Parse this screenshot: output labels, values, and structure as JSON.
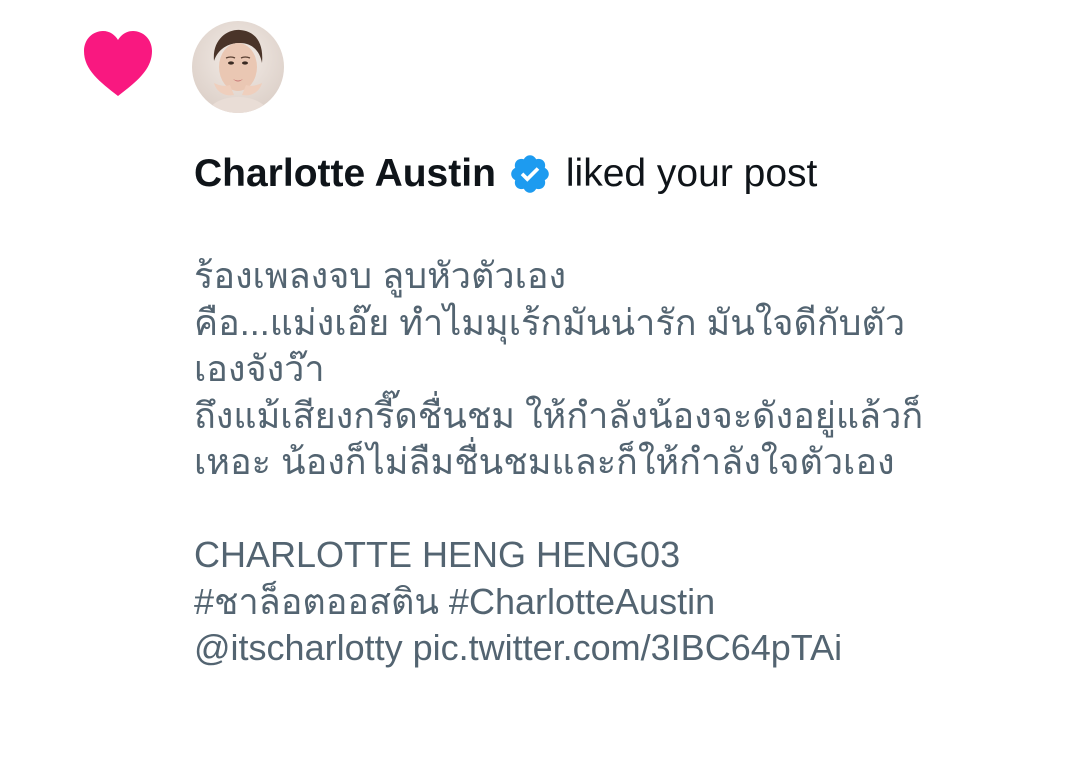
{
  "notification": {
    "icon": "heart-icon",
    "icon_color": "#f91880",
    "avatar": "avatar",
    "user": {
      "name": "Charlotte Austin",
      "verified": true,
      "verified_color": "#1d9bf0"
    },
    "action": "liked your post",
    "post": {
      "paragraph_1": [
        "ร้องเพลงจบ ลูบหัวตัวเอง",
        "คือ...แม่งเอ๊ย ทำไมมุเร้กมันน่ารัก มันใจดีกับตัว",
        "เองจังว๊า",
        "ถึงแม้เสียงกรี๊ดชื่นชม ให้กำลังน้องจะดังอยู่แล้วก็",
        "เหอะ น้องก็ไม่ลืมชื่นชมและก็ให้กำลังใจตัวเอง"
      ],
      "paragraph_2": [
        "CHARLOTTE HENG HENG03",
        "#ชาล็อตออสติน #CharlotteAustin",
        "@itscharlotty pic.twitter.com/3IBC64pTAi"
      ]
    }
  }
}
